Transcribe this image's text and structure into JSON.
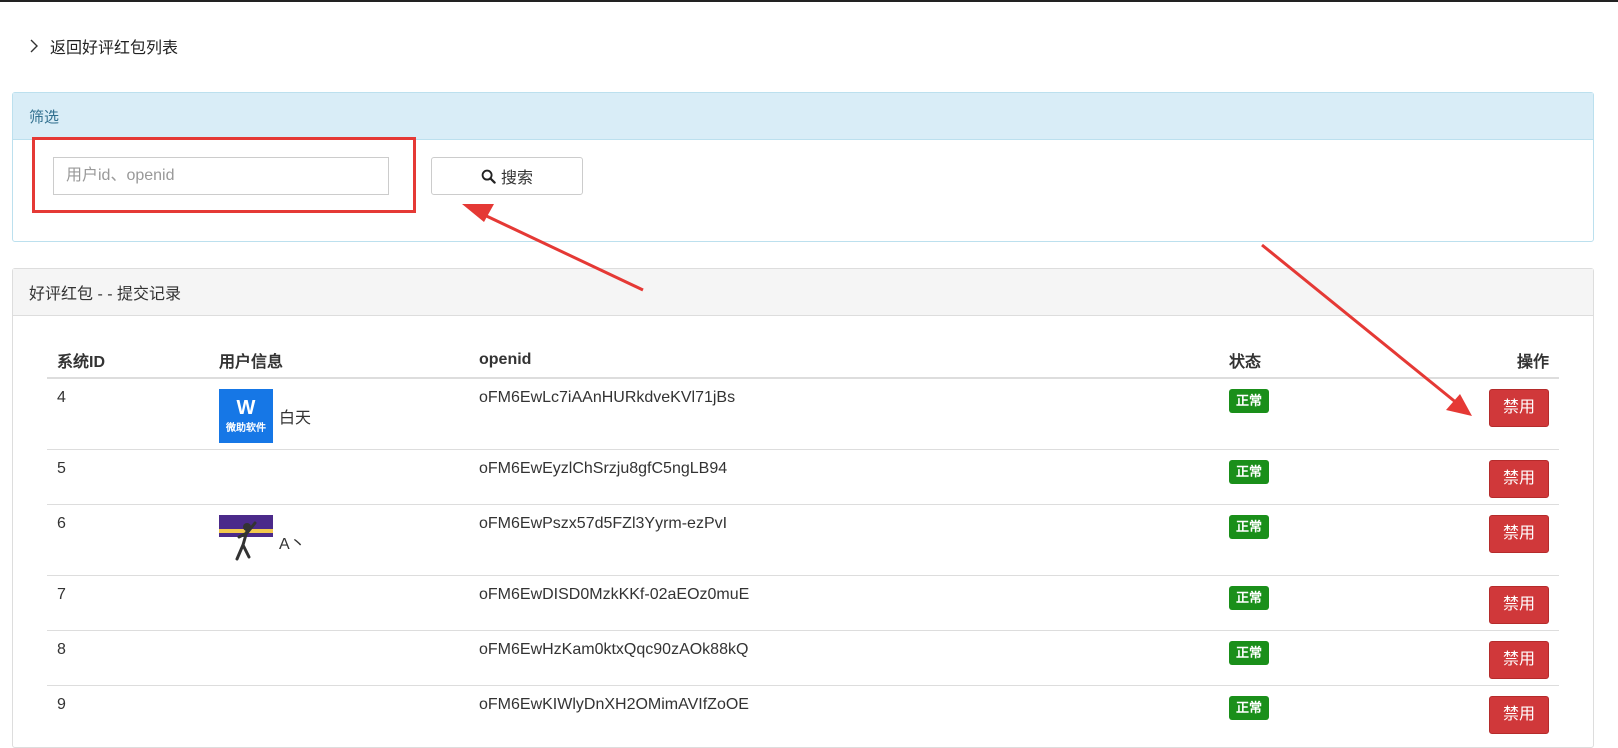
{
  "nav": {
    "back_label": "返回好评红包列表"
  },
  "filter": {
    "title": "筛选",
    "search_placeholder": "用户id、openid",
    "search_label": "搜索"
  },
  "records": {
    "title": "好评红包 - - 提交记录",
    "columns": {
      "id": "系统ID",
      "user": "用户信息",
      "openid": "openid",
      "status": "状态",
      "action": "操作"
    },
    "rows": [
      {
        "id": "4",
        "nickname": "白天",
        "avatar": "brand-logo",
        "avatar_text": "微助软件",
        "openid": "oFM6EwLc7iAAnHURkdveKVl71jBs",
        "status": "正常",
        "action": "禁用"
      },
      {
        "id": "5",
        "nickname": "",
        "avatar": "",
        "openid": "oFM6EwEyzlChSrzju8gfC5ngLB94",
        "status": "正常",
        "action": "禁用"
      },
      {
        "id": "6",
        "nickname": "A丶",
        "avatar": "basketball-photo",
        "openid": "oFM6EwPszx57d5FZl3Yyrm-ezPvI",
        "status": "正常",
        "action": "禁用"
      },
      {
        "id": "7",
        "nickname": "",
        "avatar": "",
        "openid": "oFM6EwDISD0MzkKKf-02aEOz0muE",
        "status": "正常",
        "action": "禁用"
      },
      {
        "id": "8",
        "nickname": "",
        "avatar": "",
        "openid": "oFM6EwHzKam0ktxQqc90zAOk88kQ",
        "status": "正常",
        "action": "禁用"
      },
      {
        "id": "9",
        "nickname": "",
        "avatar": "",
        "openid": "oFM6EwKIWlyDnXH2OMimAVIfZoOE",
        "status": "正常",
        "action": "禁用"
      }
    ]
  },
  "colors": {
    "annotation": "#e53935",
    "status_ok": "#1a8f1a",
    "danger": "#d0383a",
    "filter_header": "#d9edf7"
  },
  "icons": {
    "back": "chevron-right-icon",
    "search": "search-icon"
  }
}
